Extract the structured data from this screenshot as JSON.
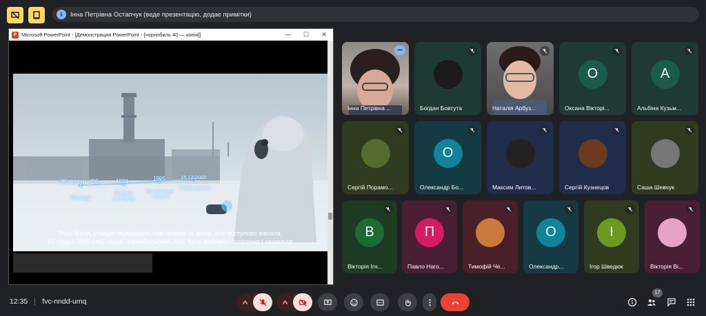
{
  "banner": {
    "info_glyph": "i",
    "text": "Інна Петрівна Остапчук (веде презентацію, додає примітки)"
  },
  "ppt": {
    "logo": "P",
    "title": "Microsoft PowerPoint - [Демонстрация PowerPoint - [чорнобиль 40 — копія]]",
    "minimize": "—",
    "maximize": "☐",
    "close": "✕",
    "timeline": {
      "t1_date": "Жовтень '86",
      "t1_label": "Рестарт",
      "t2_date": "1991",
      "t2_label_a": "Пожежа",
      "t2_label_b": "2-го блоку",
      "t3_date": "1995",
      "t3_label_a": "Меморандум",
      "t3_label_b": "закриття",
      "t4_date": "15.12.2000",
      "t4_label": "Повна зупинка"
    },
    "caption_line1": "Роки йшли, станція переживала нові пожежі та кризи, але поступово згасала.",
    "caption_line2": "15 грудня 2000 року серце Чорнобильської АЕС було зупинено остаточно і назавжди."
  },
  "participants": [
    {
      "name": "Інна Петрівна ...",
      "initial": ""
    },
    {
      "name": "Богдан Бовтута",
      "initial": ""
    },
    {
      "name": "Наталія Арбуз...",
      "initial": ""
    },
    {
      "name": "Оксана Вікторі...",
      "initial": "О"
    },
    {
      "name": "Альбіна Кузьм...",
      "initial": "А"
    },
    {
      "name": "Сергій Порамо...",
      "initial": ""
    },
    {
      "name": "Олександр Бо...",
      "initial": "О"
    },
    {
      "name": "Максим Литов...",
      "initial": ""
    },
    {
      "name": "Сергій Кузнецов",
      "initial": ""
    },
    {
      "name": "Саша Шевчук",
      "initial": ""
    },
    {
      "name": "Вікторія Ігн...",
      "initial": "В"
    },
    {
      "name": "Павло Наго...",
      "initial": "П"
    },
    {
      "name": "Тимофій Че...",
      "initial": ""
    },
    {
      "name": "Олександр...",
      "initial": "О"
    },
    {
      "name": "Ігор Шведюк",
      "initial": "І"
    },
    {
      "name": "Вікторія Ві...",
      "initial": ""
    }
  ],
  "more_options_glyph": "•••",
  "bottom": {
    "time": "12:35",
    "meeting_code": "fvc-nndd-umq",
    "people_count": "17"
  },
  "colors": {
    "accent_yellow": "#fdd663",
    "muted_red": "#f9dedc",
    "hangup_red": "#ea4335"
  }
}
